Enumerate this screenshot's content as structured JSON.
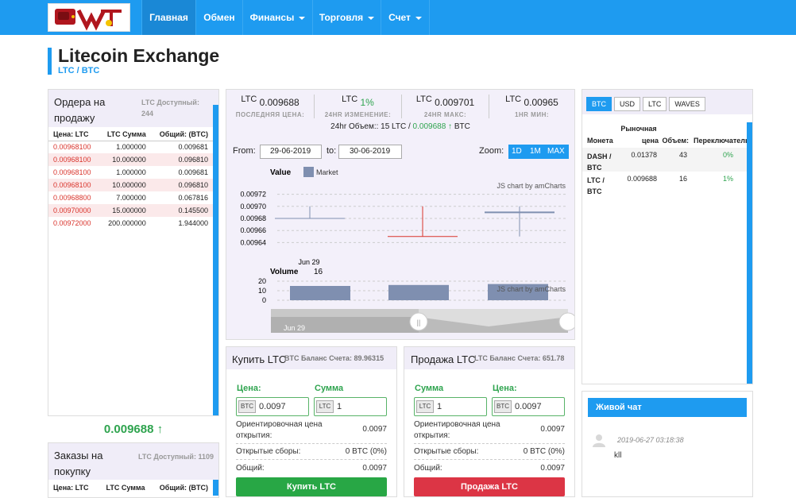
{
  "nav": {
    "items": [
      {
        "label": "Главная",
        "dropdown": false
      },
      {
        "label": "Обмен",
        "dropdown": false
      },
      {
        "label": "Финансы",
        "dropdown": true
      },
      {
        "label": "Торговля",
        "dropdown": true
      },
      {
        "label": "Счет",
        "dropdown": true
      }
    ]
  },
  "header": {
    "title": "Litecoin Exchange",
    "subtitle": "LTC / BTC"
  },
  "sell_orders": {
    "title": "Ордера на продажу",
    "available": "LTC Доступный: 244",
    "columns": [
      "Цена: LTC",
      "LTC Сумма",
      "Общий: (BTC)"
    ],
    "rows": [
      [
        "0.00968100",
        "1.000000",
        "0.009681"
      ],
      [
        "0.00968100",
        "10.000000",
        "0.096810"
      ],
      [
        "0.00968100",
        "1.000000",
        "0.009681"
      ],
      [
        "0.00968100",
        "10.000000",
        "0.096810"
      ],
      [
        "0.00968800",
        "7.000000",
        "0.067816"
      ],
      [
        "0.00970000",
        "15.000000",
        "0.145500"
      ],
      [
        "0.00972000",
        "200.000000",
        "1.944000"
      ]
    ]
  },
  "last_price": {
    "value": "0.009688",
    "arrow": "↑"
  },
  "buy_orders": {
    "title": "Заказы на покупку",
    "available": "LTC Доступный: 1109",
    "columns": [
      "Цена: LTC",
      "LTC Сумма",
      "Общий: (BTC)"
    ]
  },
  "stats": {
    "last": {
      "cur": "LTC",
      "value": "0.009688",
      "label": "ПОСЛЕДНЯЯ ЦЕНА:"
    },
    "change": {
      "cur": "LTC",
      "value": "1%",
      "label": "24HR ИЗМЕНЕНИЕ:"
    },
    "high": {
      "cur": "LTC",
      "value": "0.009701",
      "label": "24HR МАКС:"
    },
    "low": {
      "cur": "LTC",
      "value": "0.00965",
      "label": "1HR МИН:"
    },
    "volume_prefix": "24hr Объем:: 15 LTC / ",
    "volume_value": "0.009688",
    "volume_arrow": "↑",
    "volume_suffix": " BTC"
  },
  "chart_controls": {
    "from_label": "From:",
    "from_value": "29-06-2019",
    "to_label": "to:",
    "to_value": "30-06-2019",
    "zoom_label": "Zoom:",
    "zoom_buttons": [
      "1D",
      "1M",
      "MAX"
    ]
  },
  "chart_data": {
    "type": "candlestick",
    "price": {
      "title": "Value",
      "legend": "Market",
      "yticks": [
        "0.00972",
        "0.00970",
        "0.00968",
        "0.00966",
        "0.00964"
      ],
      "ylim": [
        0.00963,
        0.00973
      ],
      "xlabel_tick": "Jun 29",
      "candles": [
        {
          "open": 0.00968,
          "close": 0.00968,
          "high": 0.0097,
          "low": 0.00968,
          "color": "#7f8fb0"
        },
        {
          "open": 0.00965,
          "close": 0.00965,
          "high": 0.0097,
          "low": 0.00965,
          "color": "#d9332b"
        },
        {
          "open": 0.00969,
          "close": 0.00969,
          "high": 0.0097,
          "low": 0.00965,
          "color": "#7f8fb0"
        }
      ]
    },
    "volume": {
      "title": "Volume",
      "value": "16",
      "yticks": [
        "20",
        "10",
        "0"
      ],
      "ylim": [
        0,
        20
      ],
      "values": [
        15,
        16,
        17
      ]
    },
    "credit": "JS chart by amCharts",
    "scroll_label": "Jun 29"
  },
  "buy_form": {
    "title": "Купить LTC",
    "balance": "BTC Баланс Счета: 89.96315",
    "label1": "Цена:",
    "label2": "Сумма",
    "pre1": "BTC",
    "val1": "0.0097",
    "pre2": "LTC",
    "val2": "1",
    "est_label": "Ориентировочная цена открытия:",
    "est_value": "0.0097",
    "fee_label": "Открытые сборы:",
    "fee_value": "0 BTC (0%)",
    "total_label": "Общий:",
    "total_value": "0.0097",
    "button": "Купить LTC"
  },
  "sell_form": {
    "title": "Продажа LTC",
    "balance": "LTC Баланс Счета: 651.78",
    "label1": "Сумма",
    "label2": "Цена:",
    "pre1": "LTC",
    "val1": "1",
    "pre2": "BTC",
    "val2": "0.0097",
    "est_label": "Ориентировочная цена открытия:",
    "est_value": "0.0097",
    "fee_label": "Открытые сборы:",
    "fee_value": "0 BTC (0%)",
    "total_label": "Общий:",
    "total_value": "0.0097",
    "button": "Продажа LTC"
  },
  "market": {
    "tabs": [
      "BTC",
      "USD",
      "LTC",
      "WAVES"
    ],
    "header": {
      "coin": "Монета",
      "price1": "Рыночная",
      "price2": "цена",
      "volume": "Объем:",
      "change": "Переключатель"
    },
    "rows": [
      {
        "coin1": "DASH /",
        "coin2": "BTC",
        "price": "0.01378",
        "volume": "43",
        "change": "0%"
      },
      {
        "coin1": "LTC /",
        "coin2": "BTC",
        "price": "0.009688",
        "volume": "16",
        "change": "1%"
      }
    ]
  },
  "chat": {
    "title": "Живой чат",
    "time": "2019-06-27 03:18:38",
    "message": "kll"
  },
  "colors": {
    "accent": "#1e9bf0",
    "green": "#2fa44f",
    "red": "#d9332b"
  }
}
